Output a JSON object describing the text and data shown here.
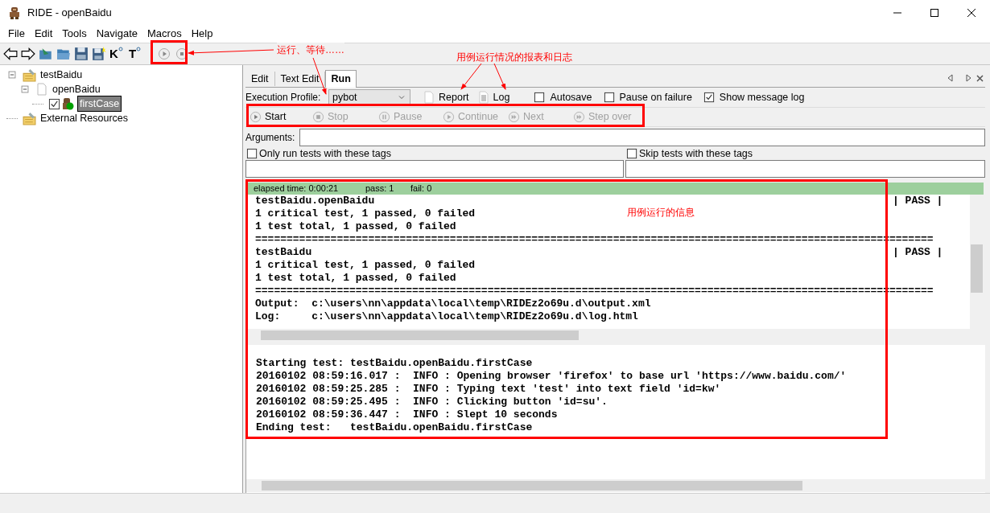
{
  "window": {
    "title": "RIDE - openBaidu"
  },
  "menu": [
    "File",
    "Edit",
    "Tools",
    "Navigate",
    "Macros",
    "Help"
  ],
  "toolbar": [
    {
      "kind": "back"
    },
    {
      "kind": "forward"
    },
    {
      "kind": "open_suite"
    },
    {
      "kind": "open_dir"
    },
    {
      "kind": "save"
    },
    {
      "kind": "save_all"
    },
    {
      "kind": "search",
      "glyph": "K"
    },
    {
      "kind": "search",
      "glyph": "T"
    },
    {
      "kind": "run"
    },
    {
      "kind": "stop"
    }
  ],
  "tree": [
    {
      "label": "testBaidu",
      "kind": "suite",
      "expanded": true,
      "children": [
        {
          "label": "openBaidu",
          "kind": "file",
          "expanded": true,
          "children": [
            {
              "label": "firstCase",
              "kind": "test",
              "checked": true,
              "selected": true
            }
          ]
        }
      ]
    },
    {
      "label": "External Resources",
      "kind": "suite"
    }
  ],
  "tabs": [
    {
      "label": "Edit",
      "selected": false
    },
    {
      "label": "Text Edit",
      "selected": false
    },
    {
      "label": "Run",
      "selected": true
    }
  ],
  "run": {
    "profile_label": "Execution Profile:",
    "profile": "pybot",
    "report": "Report",
    "log": "Log",
    "options": [
      {
        "label": "Autosave",
        "checked": false
      },
      {
        "label": "Pause on failure",
        "checked": false
      },
      {
        "label": "Show message log",
        "checked": true
      }
    ],
    "controls": [
      {
        "label": "Start",
        "kind": "play",
        "disabled": false
      },
      {
        "label": "Stop",
        "kind": "stop",
        "disabled": true
      },
      {
        "label": "Pause",
        "kind": "pause",
        "disabled": true
      },
      {
        "label": "Continue",
        "kind": "play",
        "disabled": true
      },
      {
        "label": "Next",
        "kind": "next",
        "disabled": true
      },
      {
        "label": "Step over",
        "kind": "next",
        "disabled": true
      }
    ],
    "arguments_label": "Arguments:",
    "tag_filters": [
      {
        "label": "Only run tests with these tags",
        "checked": false
      },
      {
        "label": "Skip tests with these tags",
        "checked": false
      }
    ]
  },
  "status": {
    "elapsed": "elapsed time: 0:00:21",
    "pass": "pass: 1",
    "fail": "fail: 0"
  },
  "output_lines": [
    {
      "text": "testBaidu.openBaidu",
      "status": "| PASS |"
    },
    {
      "text": "1 critical test, 1 passed, 0 failed"
    },
    {
      "text": "1 test total, 1 passed, 0 failed"
    },
    {
      "text": "============================================================================================================"
    },
    {
      "text": "testBaidu",
      "status": "| PASS |"
    },
    {
      "text": "1 critical test, 1 passed, 0 failed"
    },
    {
      "text": "1 test total, 1 passed, 0 failed"
    },
    {
      "text": "============================================================================================================"
    },
    {
      "text": "Output:  c:\\users\\nn\\appdata\\local\\temp\\RIDEz2o69u.d\\output.xml"
    },
    {
      "text": "Log:     c:\\users\\nn\\appdata\\local\\temp\\RIDEz2o69u.d\\log.html"
    }
  ],
  "log_lines": [
    "Starting test: testBaidu.openBaidu.firstCase",
    "20160102 08:59:16.017 :  INFO : Opening browser 'firefox' to base url 'https://www.baidu.com/'",
    "20160102 08:59:25.285 :  INFO : Typing text 'test' into text field 'id=kw'",
    "20160102 08:59:25.495 :  INFO : Clicking button 'id=su'.",
    "20160102 08:59:36.447 :  INFO : Slept 10 seconds",
    "Ending test:   testBaidu.openBaidu.firstCase"
  ],
  "annotations": [
    {
      "text": "运行、等待……"
    },
    {
      "text": "用例运行情况的报表和日志"
    },
    {
      "text": "用例运行的信息"
    }
  ]
}
